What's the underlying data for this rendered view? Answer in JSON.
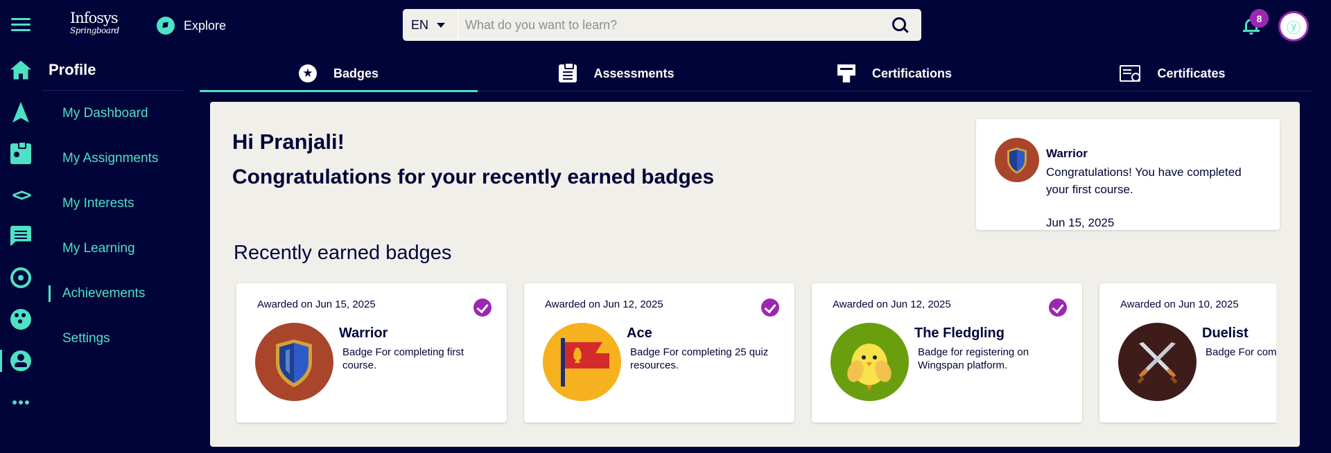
{
  "header": {
    "brand_line1": "Infosys",
    "brand_line2": "Springboard",
    "explore_label": "Explore",
    "language": "EN",
    "search_placeholder": "What do you want to learn?",
    "notification_count": "8"
  },
  "rail": {
    "icons": [
      "home-icon",
      "navigation-icon",
      "badge-id-icon",
      "code-icon",
      "chat-icon",
      "target-icon",
      "bubbles-icon",
      "account-icon",
      "more-icon"
    ],
    "active": "account-icon"
  },
  "profile_menu": {
    "title": "Profile",
    "items": [
      {
        "label": "My Dashboard"
      },
      {
        "label": "My Assignments"
      },
      {
        "label": "My Interests"
      },
      {
        "label": "My Learning"
      },
      {
        "label": "Achievements"
      },
      {
        "label": "Settings"
      }
    ],
    "active": "Achievements"
  },
  "tabs": [
    {
      "label": "Badges",
      "icon": "star-badge-icon"
    },
    {
      "label": "Assessments",
      "icon": "clipboard-icon"
    },
    {
      "label": "Certifications",
      "icon": "certification-icon"
    },
    {
      "label": "Certificates",
      "icon": "certificate-icon"
    }
  ],
  "active_tab": "Badges",
  "main": {
    "greeting": "Hi Pranjali!",
    "subtitle": "Congratulations for your recently earned badges",
    "notification": {
      "title": "Warrior",
      "message": "Congratulations! You have completed your first course.",
      "date": "Jun 15, 2025"
    },
    "recent_heading": "Recently earned badges",
    "badges": [
      {
        "awarded": "Awarded on Jun 15, 2025",
        "title": "Warrior",
        "desc": "Badge For completing first course.",
        "color": "#a9452a",
        "earned": true
      },
      {
        "awarded": "Awarded on Jun 12, 2025",
        "title": "Ace",
        "desc": "Badge For completing 25 quiz resources.",
        "color": "#f5b21e",
        "earned": true
      },
      {
        "awarded": "Awarded on Jun 12, 2025",
        "title": "The Fledgling",
        "desc": "Badge for registering on Wingspan platform.",
        "color": "#6a9e0f",
        "earned": true
      },
      {
        "awarded": "Awarded on Jun 10, 2025",
        "title": "Duelist",
        "desc": "Badge For completing resource.",
        "color": "#3e1c1a",
        "earned": false
      }
    ]
  },
  "colors": {
    "background": "#000439",
    "accent": "#4de2c4",
    "panel": "#f0efea",
    "badge_check": "#9c27b0"
  }
}
